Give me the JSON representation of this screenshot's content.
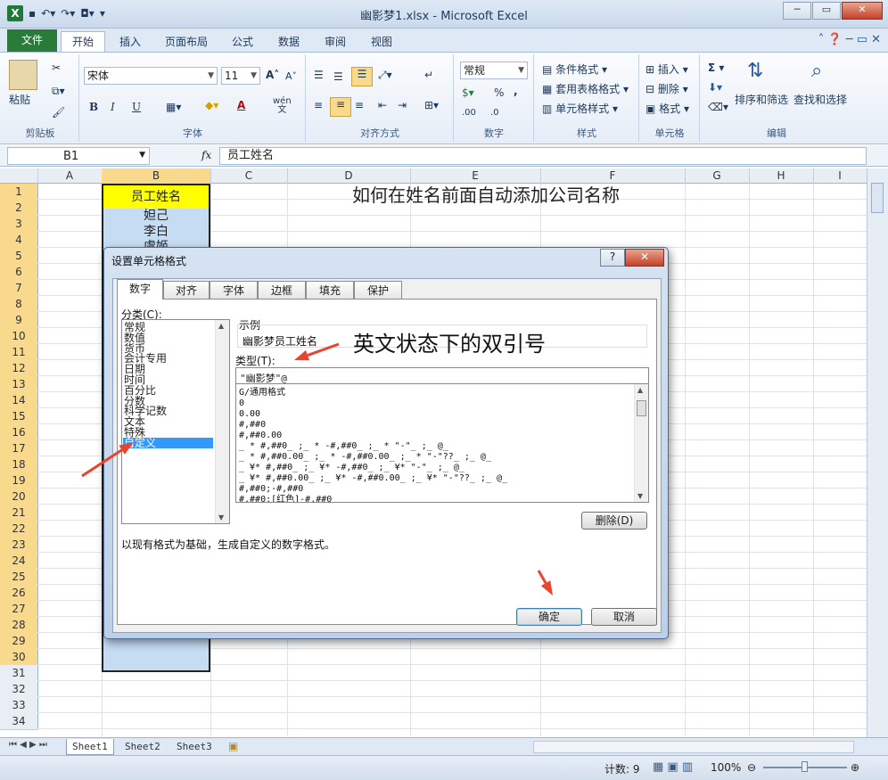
{
  "window": {
    "title": "幽影梦1.xlsx - Microsoft Excel",
    "controls": {
      "minimize": "─",
      "restore": "▭",
      "close": "✕"
    }
  },
  "ribbon_tabs": [
    "文件",
    "开始",
    "插入",
    "页面布局",
    "公式",
    "数据",
    "审阅",
    "视图"
  ],
  "ribbon": {
    "clipboard": {
      "label": "剪贴板",
      "paste": "粘贴"
    },
    "font": {
      "label": "字体",
      "name": "宋体",
      "size": "11",
      "bold": "B",
      "italic": "I",
      "underline": "U",
      "grow": "A˄",
      "shrink": "A˅",
      "color_letter": "A",
      "wen": "wén",
      "wen2": "文"
    },
    "align": {
      "label": "对齐方式"
    },
    "number": {
      "label": "数字",
      "format": "常规",
      "percent": "%",
      "comma": ",",
      "inc_dec": ".00",
      "dec_dec": ".0"
    },
    "styles": {
      "label": "样式",
      "items": [
        "条件格式",
        "套用表格格式",
        "单元格样式"
      ]
    },
    "cells": {
      "label": "单元格",
      "items": [
        "插入",
        "删除",
        "格式"
      ]
    },
    "editing": {
      "label": "编辑",
      "sum": "Σ",
      "sort": "排序和筛选",
      "find": "查找和选择"
    }
  },
  "formula_bar": {
    "cell_ref": "B1",
    "fx": "fx",
    "content": "员工姓名"
  },
  "columns": [
    "A",
    "B",
    "C",
    "D",
    "E",
    "F",
    "G",
    "H",
    "I"
  ],
  "rows": [
    "1",
    "2",
    "3",
    "4",
    "5",
    "6",
    "7",
    "8",
    "9",
    "10",
    "11",
    "12",
    "13",
    "14",
    "15",
    "16",
    "17",
    "18",
    "19",
    "20",
    "21",
    "22",
    "23",
    "24",
    "25",
    "26",
    "27",
    "28",
    "29",
    "30",
    "31",
    "32",
    "33",
    "34"
  ],
  "cells": {
    "b1": "员工姓名",
    "b2": "妲己",
    "b3": "李白",
    "b4": "虞姬",
    "sheet_title": "如何在姓名前面自动添加公司名称"
  },
  "sheets": [
    "Sheet1",
    "Sheet2",
    "Sheet3"
  ],
  "status": {
    "count": "计数: 9",
    "zoom": "100%"
  },
  "dialog": {
    "title": "设置单元格格式",
    "help": "?",
    "close": "✕",
    "tabs": [
      "数字",
      "对齐",
      "字体",
      "边框",
      "填充",
      "保护"
    ],
    "category_label": "分类(C):",
    "categories": [
      "常规",
      "数值",
      "货币",
      "会计专用",
      "日期",
      "时间",
      "百分比",
      "分数",
      "科学记数",
      "文本",
      "特殊",
      "自定义"
    ],
    "selected_category": "自定义",
    "sample_label": "示例",
    "sample_value": "幽影梦员工姓名",
    "type_label": "类型(T):",
    "type_value": "\"幽影梦\"@",
    "formats": [
      "G/通用格式",
      "0",
      "0.00",
      "#,##0",
      "#,##0.00",
      "_ * #,##0_ ;_ * -#,##0_ ;_ * \"-\"_ ;_ @_",
      "_ * #,##0.00_ ;_ * -#,##0.00_ ;_ * \"-\"??_ ;_ @_",
      "_ ¥* #,##0_ ;_ ¥* -#,##0_ ;_ ¥* \"-\"_ ;_ @_",
      "_ ¥* #,##0.00_ ;_ ¥* -#,##0.00_ ;_ ¥* \"-\"??_ ;_ @_",
      "#,##0;-#,##0",
      "#,##0;[红色]-#,##0"
    ],
    "delete_button": "删除(D)",
    "description": "以现有格式为基础，生成自定义的数字格式。",
    "ok": "确定",
    "cancel": "取消"
  },
  "annotation": {
    "text": "英文状态下的双引号",
    "color": "#e8442e"
  }
}
